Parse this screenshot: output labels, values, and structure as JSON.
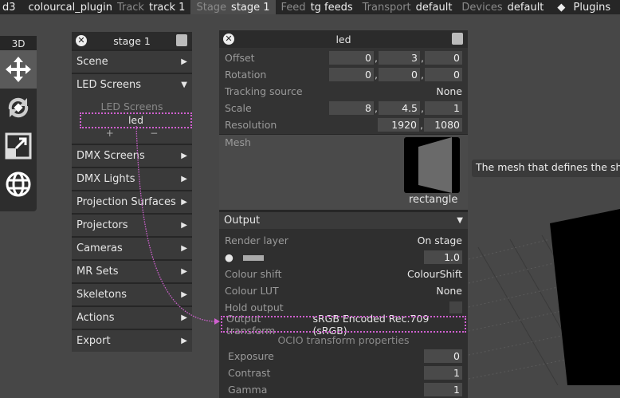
{
  "topbar": {
    "app": "d3",
    "project": "colourcal_plugin",
    "track_label": "Track",
    "track": "track 1",
    "stage_label": "Stage",
    "stage": "stage 1",
    "feed_label": "Feed",
    "feed": "tg feeds",
    "transport_label": "Transport",
    "transport": "default",
    "devices_label": "Devices",
    "devices": "default",
    "plugins": "Plugins"
  },
  "toolbar": {
    "mode": "3D",
    "tools": [
      "move-icon",
      "rotate-icon",
      "scale-icon",
      "globe-icon"
    ],
    "active": "move-icon"
  },
  "stage_panel": {
    "title": "stage 1",
    "sections": [
      {
        "label": "Scene",
        "state": "collapsed"
      },
      {
        "label": "LED Screens",
        "state": "expanded"
      },
      {
        "label": "DMX Screens",
        "state": "collapsed"
      },
      {
        "label": "DMX Lights",
        "state": "collapsed"
      },
      {
        "label": "Projection Surfaces",
        "state": "collapsed"
      },
      {
        "label": "Projectors",
        "state": "collapsed"
      },
      {
        "label": "Cameras",
        "state": "collapsed"
      },
      {
        "label": "MR Sets",
        "state": "collapsed"
      },
      {
        "label": "Skeletons",
        "state": "collapsed"
      },
      {
        "label": "Actions",
        "state": "collapsed"
      },
      {
        "label": "Export",
        "state": "collapsed"
      }
    ],
    "led_list": {
      "header": "LED Screens",
      "items": [
        "led"
      ],
      "add": "+",
      "remove": "−"
    }
  },
  "led_panel": {
    "title": "led",
    "offset": {
      "label": "Offset",
      "values": [
        "0",
        "3",
        "0"
      ]
    },
    "rotation": {
      "label": "Rotation",
      "values": [
        "0",
        "0",
        "0"
      ]
    },
    "tracking": {
      "label": "Tracking source",
      "value": "None"
    },
    "scale": {
      "label": "Scale",
      "values": [
        "8",
        "4.5",
        "1"
      ]
    },
    "resolution": {
      "label": "Resolution",
      "values": [
        "1920",
        "1080"
      ]
    },
    "mesh": {
      "label": "Mesh",
      "value": "rectangle"
    },
    "output": {
      "header": "Output",
      "render_layer": {
        "label": "Render layer",
        "value": "On stage"
      },
      "brightness": "1.0",
      "colour_shift": {
        "label": "Colour shift",
        "value": "ColourShift"
      },
      "colour_lut": {
        "label": "Colour LUT",
        "value": "None"
      },
      "hold_output": {
        "label": "Hold output",
        "checked": false
      },
      "output_transform": {
        "label": "Output transform",
        "value": "sRGB Encoded Rec.709 (sRGB)"
      },
      "ocio_header": "OCIO transform properties",
      "exposure": {
        "label": "Exposure",
        "value": "0"
      },
      "contrast": {
        "label": "Contrast",
        "value": "1"
      },
      "gamma": {
        "label": "Gamma",
        "value": "1"
      }
    }
  },
  "tooltip": "The mesh that defines the sha",
  "colors": {
    "highlight": "#d060d0",
    "panel": "#262626",
    "row": "#3a3a3a"
  }
}
